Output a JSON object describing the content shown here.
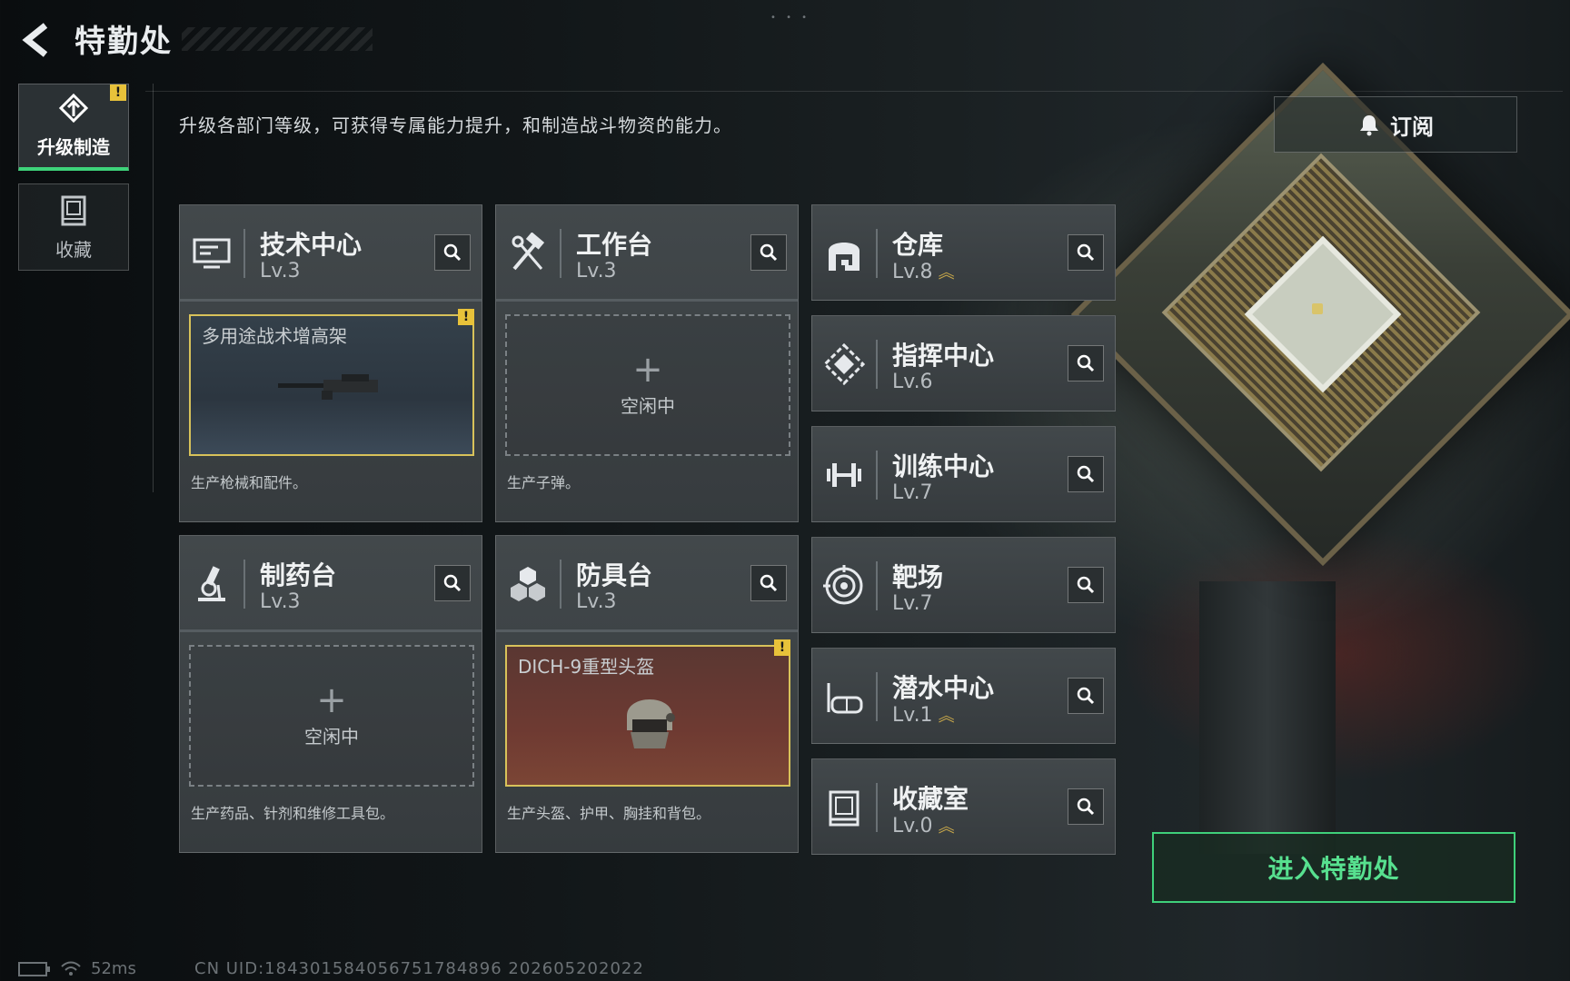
{
  "header": {
    "title": "特勤处"
  },
  "nav": {
    "tabs": [
      {
        "label": "升级制造",
        "active": true,
        "alert": "!"
      },
      {
        "label": "收藏",
        "active": false
      }
    ]
  },
  "description": "升级各部门等级，可获得专属能力提升，和制造战斗物资的能力。",
  "subscribe": {
    "label": "订阅"
  },
  "departments": {
    "tech": {
      "name": "技术中心",
      "level": "Lv.3",
      "desc": "生产枪械和配件。",
      "slot": {
        "state": "crafting",
        "item": "多用途战术增高架",
        "alert": "!"
      }
    },
    "workbench": {
      "name": "工作台",
      "level": "Lv.3",
      "desc": "生产子弹。",
      "slot": {
        "state": "idle",
        "label": "空闲中"
      }
    },
    "pharmacy": {
      "name": "制药台",
      "level": "Lv.3",
      "desc": "生产药品、针剂和维修工具包。",
      "slot": {
        "state": "idle",
        "label": "空闲中"
      }
    },
    "armor": {
      "name": "防具台",
      "level": "Lv.3",
      "desc": "生产头盔、护甲、胸挂和背包。",
      "slot": {
        "state": "crafting",
        "item": "DICH-9重型头盔",
        "alert": "!"
      }
    },
    "warehouse": {
      "name": "仓库",
      "level": "Lv.8",
      "upgradable": true
    },
    "command": {
      "name": "指挥中心",
      "level": "Lv.6",
      "upgradable": false
    },
    "training": {
      "name": "训练中心",
      "level": "Lv.7",
      "upgradable": false
    },
    "range": {
      "name": "靶场",
      "level": "Lv.7",
      "upgradable": false
    },
    "diving": {
      "name": "潜水中心",
      "level": "Lv.1",
      "upgradable": true
    },
    "collection": {
      "name": "收藏室",
      "level": "Lv.0",
      "upgradable": true
    }
  },
  "enter_button": {
    "label": "进入特勤处"
  },
  "status": {
    "ping": "52ms",
    "uid": "CN UID:184301584056751784896 202605202022"
  },
  "colors": {
    "accent_green": "#3fd07a",
    "alert_yellow": "#e8c23a",
    "item_border": "#d8c25a"
  }
}
